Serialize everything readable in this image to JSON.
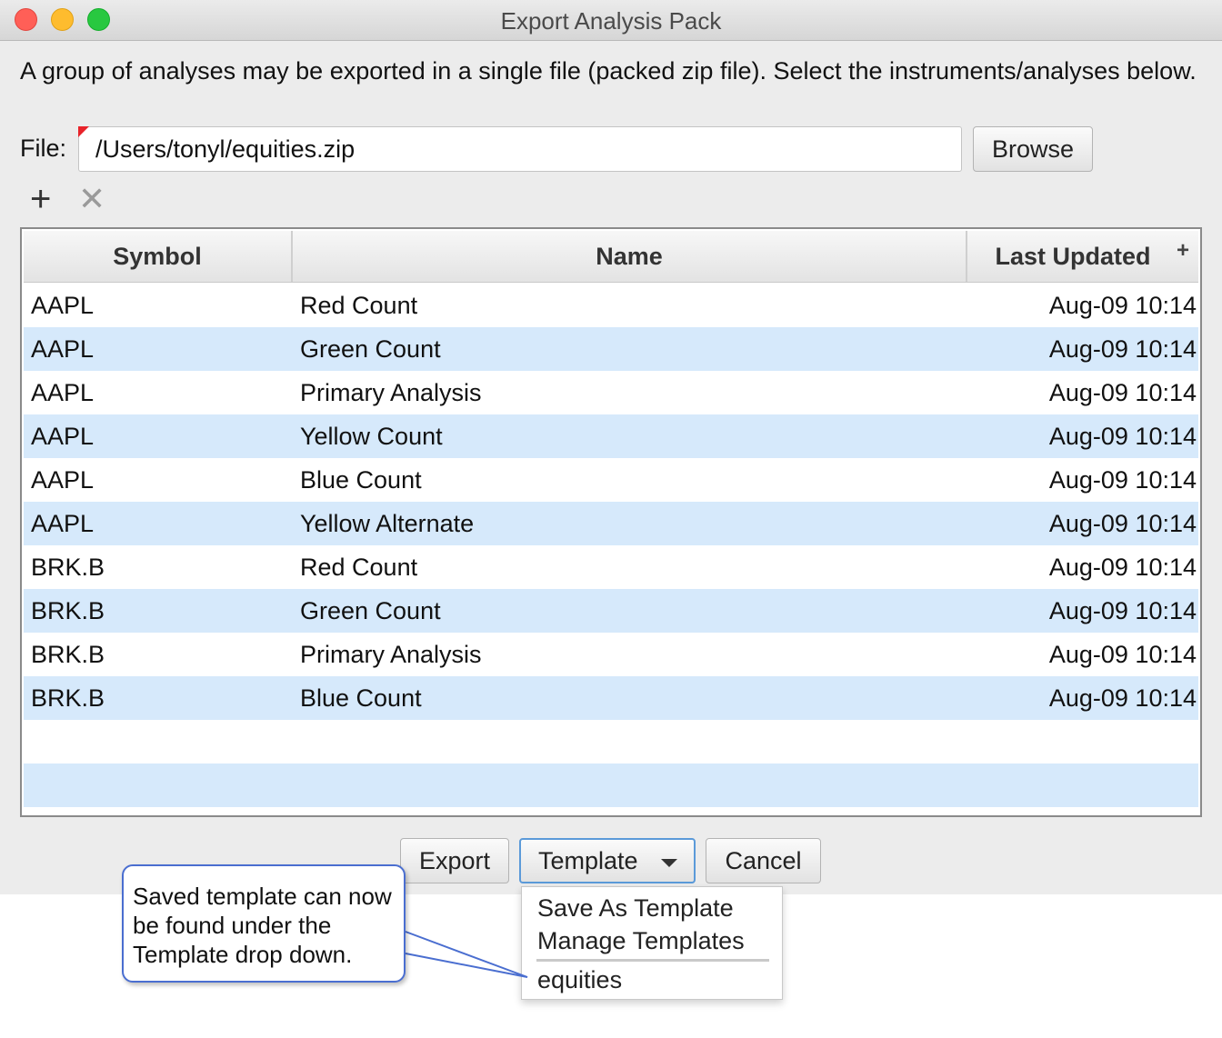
{
  "window": {
    "title": "Export Analysis Pack"
  },
  "description": "A group of analyses may be exported in a single file (packed zip file). Select the instruments/analyses below.",
  "file": {
    "label": "File:",
    "value": "/Users/tonyl/equities.zip",
    "browse_label": "Browse"
  },
  "toolbar": {
    "add_icon": "plus-icon",
    "remove_icon": "close-icon",
    "add_glyph": "+",
    "remove_glyph": "✕"
  },
  "table": {
    "columns": [
      "Symbol",
      "Name",
      "Last Updated"
    ],
    "add_column_glyph": "+",
    "rows": [
      {
        "symbol": "AAPL",
        "name": "Red Count",
        "updated": "Aug-09 10:14"
      },
      {
        "symbol": "AAPL",
        "name": "Green Count",
        "updated": "Aug-09 10:14"
      },
      {
        "symbol": "AAPL",
        "name": "Primary Analysis",
        "updated": "Aug-09 10:14"
      },
      {
        "symbol": "AAPL",
        "name": "Yellow Count",
        "updated": "Aug-09 10:14"
      },
      {
        "symbol": "AAPL",
        "name": "Blue Count",
        "updated": "Aug-09 10:14"
      },
      {
        "symbol": "AAPL",
        "name": "Yellow Alternate",
        "updated": "Aug-09 10:14"
      },
      {
        "symbol": "BRK.B",
        "name": "Red Count",
        "updated": "Aug-09 10:14"
      },
      {
        "symbol": "BRK.B",
        "name": "Green Count",
        "updated": "Aug-09 10:14"
      },
      {
        "symbol": "BRK.B",
        "name": "Primary Analysis",
        "updated": "Aug-09 10:14"
      },
      {
        "symbol": "BRK.B",
        "name": "Blue Count",
        "updated": "Aug-09 10:14"
      },
      {
        "symbol": "",
        "name": "",
        "updated": ""
      },
      {
        "symbol": "",
        "name": "",
        "updated": ""
      }
    ]
  },
  "buttons": {
    "export": "Export",
    "template": "Template",
    "cancel": "Cancel"
  },
  "template_menu": {
    "items": [
      "Save As Template",
      "Manage Templates"
    ],
    "saved": [
      "equities"
    ]
  },
  "callout": {
    "text": "Saved template can now be found under the Template drop down."
  },
  "colors": {
    "row_alt": "#d6e9fb",
    "accent": "#5b9ad9",
    "flag": "#e8232a",
    "callout_border": "#4a6ed0"
  }
}
